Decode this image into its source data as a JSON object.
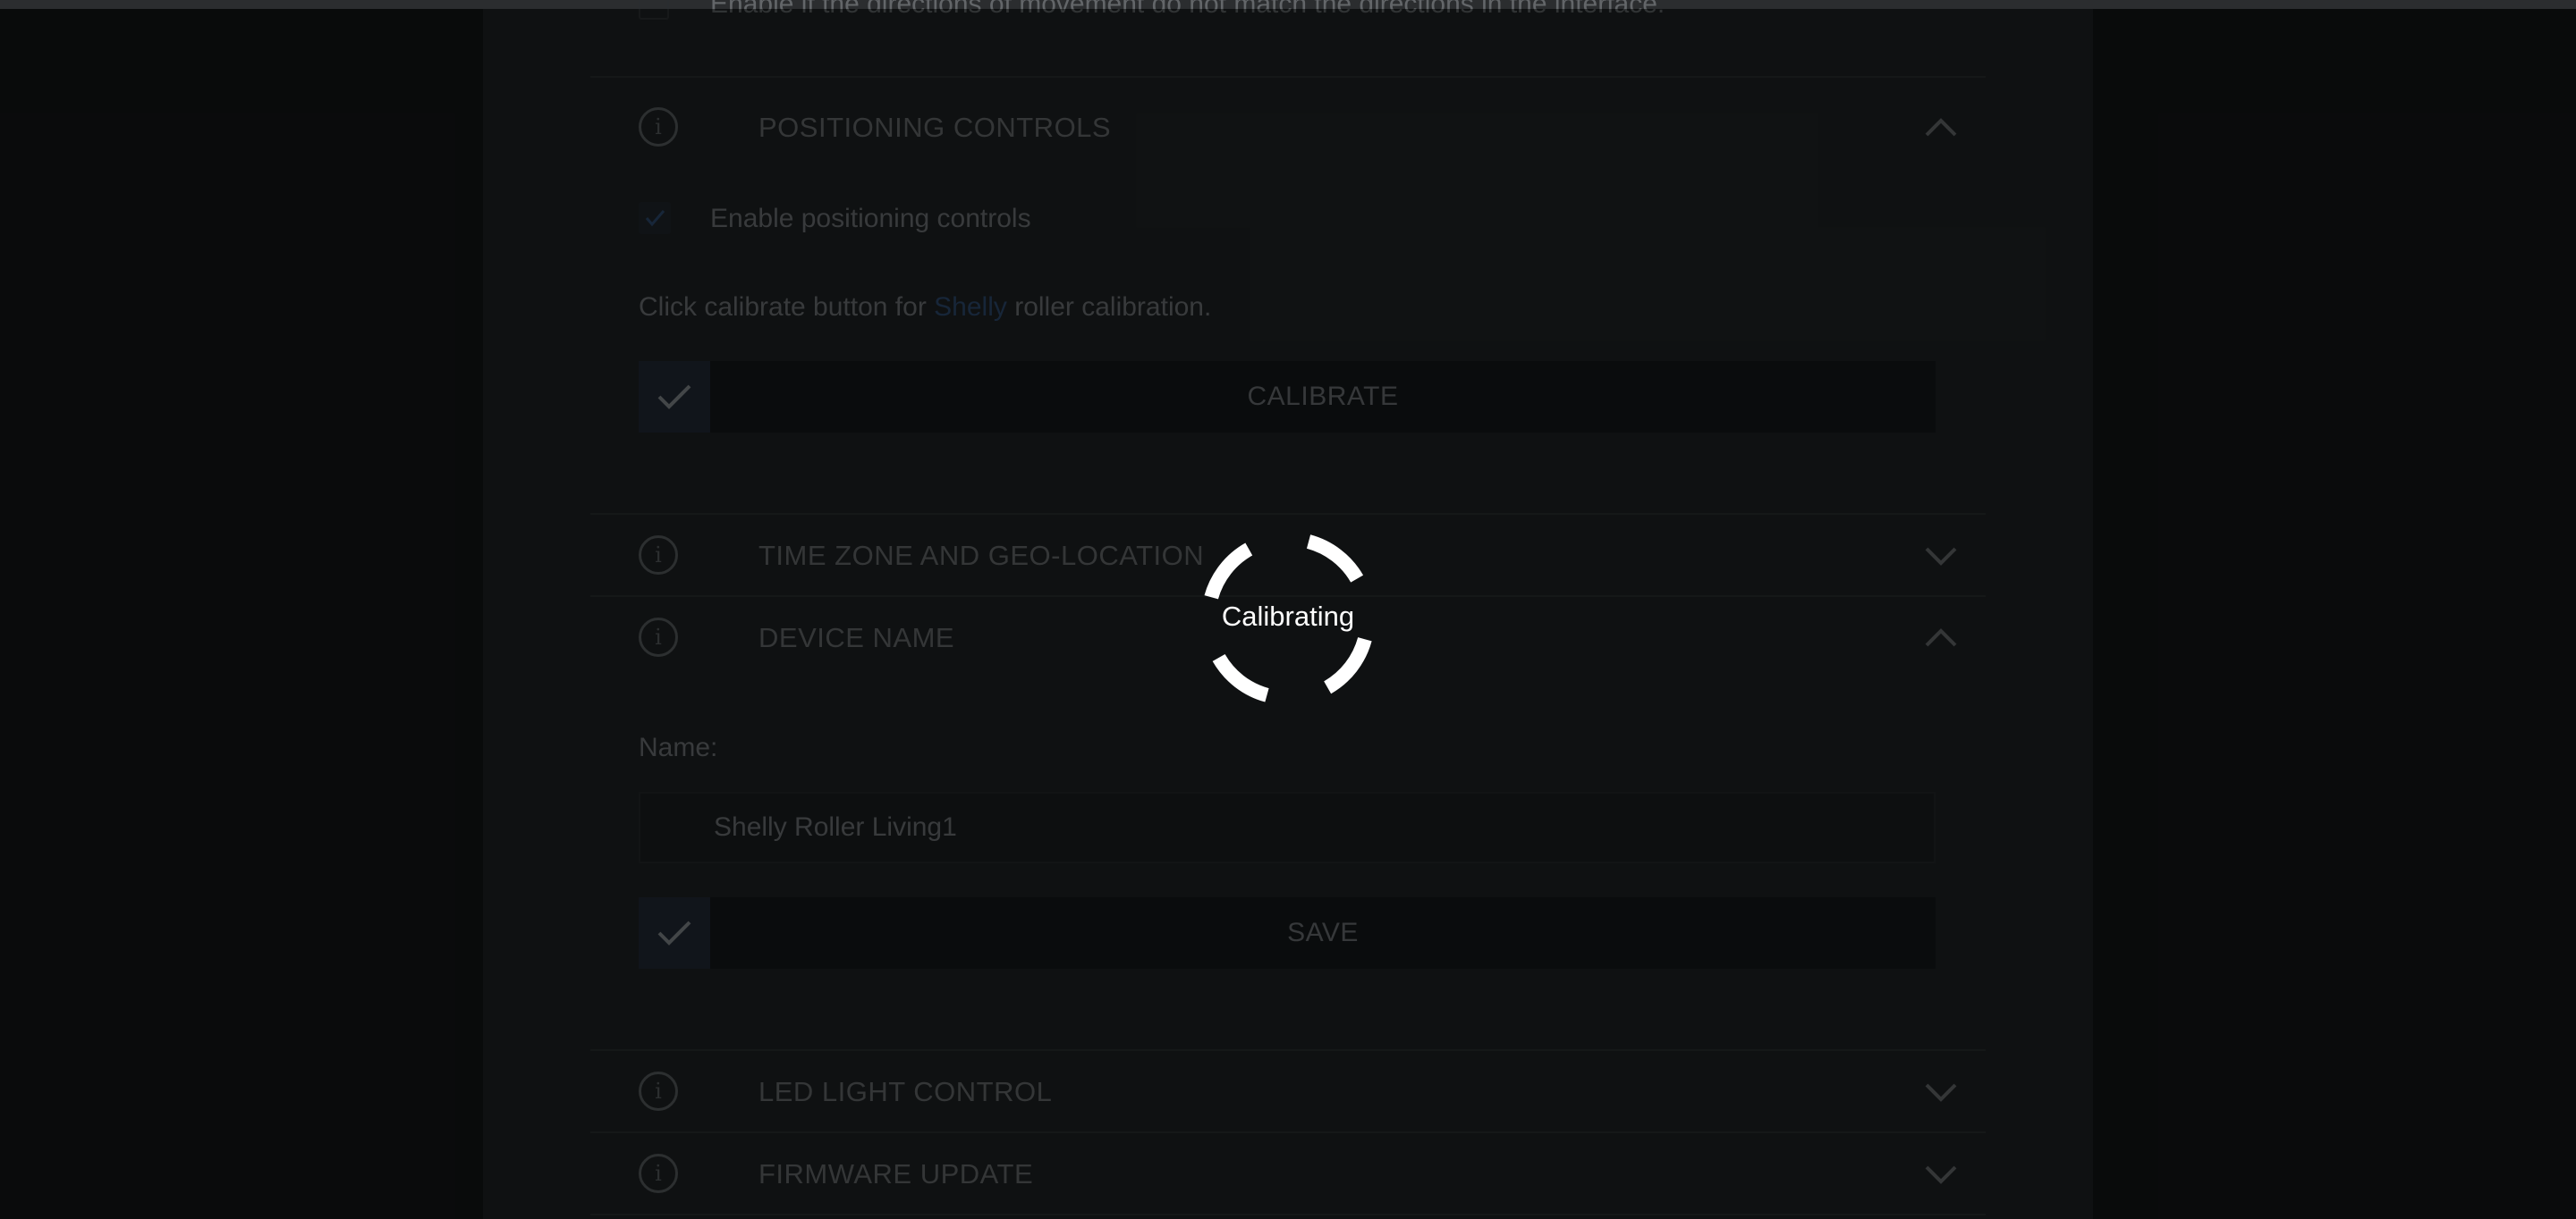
{
  "top_note": {
    "text": "Enable if the directions of movement do not match the directions in the interface."
  },
  "sections": {
    "positioning": {
      "title": "POSITIONING CONTROLS",
      "expanded": true,
      "checkbox_label": "Enable positioning controls",
      "checkbox_checked": true,
      "calibrate_text_before": "Click calibrate button for",
      "calibrate_link": "Shelly",
      "calibrate_text_after": "roller calibration.",
      "calibrate_button": "CALIBRATE"
    },
    "timezone": {
      "title": "TIME ZONE AND GEO-LOCATION",
      "expanded": false
    },
    "device_name": {
      "title": "DEVICE NAME",
      "expanded": true,
      "name_label": "Name:",
      "name_value": "Shelly Roller Living1",
      "save_button": "SAVE"
    },
    "led": {
      "title": "LED LIGHT CONTROL",
      "expanded": false
    },
    "firmware": {
      "title": "FIRMWARE UPDATE",
      "expanded": false
    }
  },
  "loading": {
    "label": "Calibrating"
  },
  "colors": {
    "accent_link": "#2c4a73",
    "check_box_bg": "#1d2532",
    "panel_bg": "#1a1c1d",
    "page_bg": "#0c0e0e"
  },
  "icons": {
    "info": "info-circle-icon",
    "expand": "chevron-down-icon",
    "collapse": "chevron-up-icon",
    "check": "checkmark-icon"
  }
}
